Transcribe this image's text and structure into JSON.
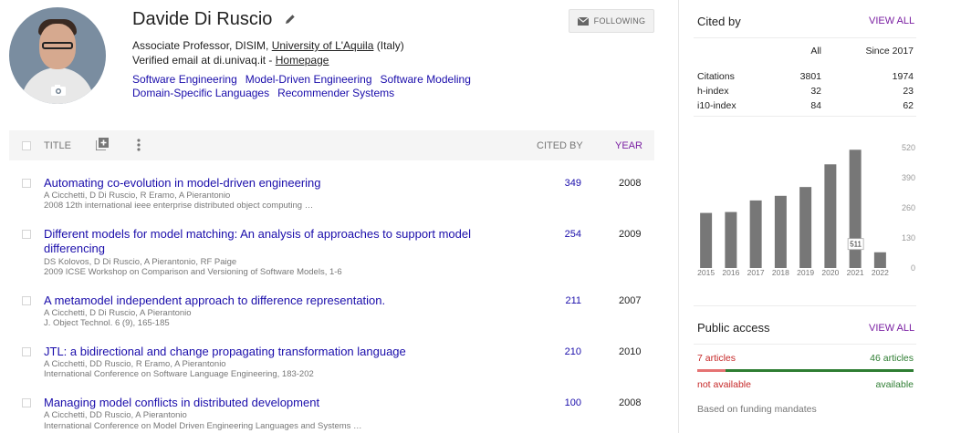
{
  "profile": {
    "name": "Davide Di Ruscio",
    "affiliation_prefix": "Associate Professor, DISIM, ",
    "affiliation_link": "University of L'Aquila",
    "affiliation_suffix": " (Italy)",
    "email_prefix": "Verified email at di.univaq.it - ",
    "homepage": "Homepage",
    "interests": [
      "Software Engineering",
      "Model-Driven Engineering",
      "Software Modeling",
      "Domain-Specific Languages",
      "Recommender Systems"
    ],
    "follow_label": "FOLLOWING",
    "icons": {
      "edit": "pencil-icon",
      "camera": "camera-icon",
      "mail": "mail-icon"
    }
  },
  "table": {
    "col_title": "TITLE",
    "col_cited": "CITED BY",
    "col_year": "YEAR",
    "icons": {
      "add": "add-box-icon",
      "more": "more-vert-icon"
    },
    "rows": [
      {
        "title": "Automating co-evolution in model-driven engineering",
        "authors": "A Cicchetti, D Di Ruscio, R Eramo, A Pierantonio",
        "venue": "2008 12th international ieee enterprise distributed object computing …",
        "cited": "349",
        "year": "2008"
      },
      {
        "title": "Different models for model matching: An analysis of approaches to support model differencing",
        "authors": "DS Kolovos, D Di Ruscio, A Pierantonio, RF Paige",
        "venue": "2009 ICSE Workshop on Comparison and Versioning of Software Models, 1-6",
        "cited": "254",
        "year": "2009"
      },
      {
        "title": "A metamodel independent approach to difference representation.",
        "authors": "A Cicchetti, D Di Ruscio, A Pierantonio",
        "venue": "J. Object Technol. 6 (9), 165-185",
        "cited": "211",
        "year": "2007"
      },
      {
        "title": "JTL: a bidirectional and change propagating transformation language",
        "authors": "A Cicchetti, DD Ruscio, R Eramo, A Pierantonio",
        "venue": "International Conference on Software Language Engineering, 183-202",
        "cited": "210",
        "year": "2010"
      },
      {
        "title": "Managing model conflicts in distributed development",
        "authors": "A Cicchetti, DD Ruscio, A Pierantonio",
        "venue": "International Conference on Model Driven Engineering Languages and Systems …",
        "cited": "100",
        "year": "2008"
      }
    ]
  },
  "cited_by": {
    "title": "Cited by",
    "view_all": "VIEW ALL",
    "col_all": "All",
    "col_since": "Since 2017",
    "stats": [
      {
        "label": "Citations",
        "all": "3801",
        "since": "1974"
      },
      {
        "label": "h-index",
        "all": "32",
        "since": "23"
      },
      {
        "label": "i10-index",
        "all": "84",
        "since": "62"
      }
    ]
  },
  "chart_data": {
    "type": "bar",
    "categories": [
      "2015",
      "2016",
      "2017",
      "2018",
      "2019",
      "2020",
      "2021",
      "2022"
    ],
    "values": [
      238,
      242,
      292,
      312,
      350,
      448,
      511,
      68
    ],
    "ylim": [
      0,
      520
    ],
    "yticks": [
      "520",
      "390",
      "260",
      "130",
      "0"
    ],
    "tooltip": {
      "category": "2021",
      "value": "511"
    },
    "grid": false,
    "bar_color": "#777777"
  },
  "public_access": {
    "title": "Public access",
    "view_all": "VIEW ALL",
    "not_available_count": "7 articles",
    "available_count": "46 articles",
    "not_available_label": "not available",
    "available_label": "available",
    "not_available_fraction": 0.132,
    "note": "Based on funding mandates",
    "colors": {
      "not_available": "#c62828",
      "available": "#2e7d32"
    }
  }
}
